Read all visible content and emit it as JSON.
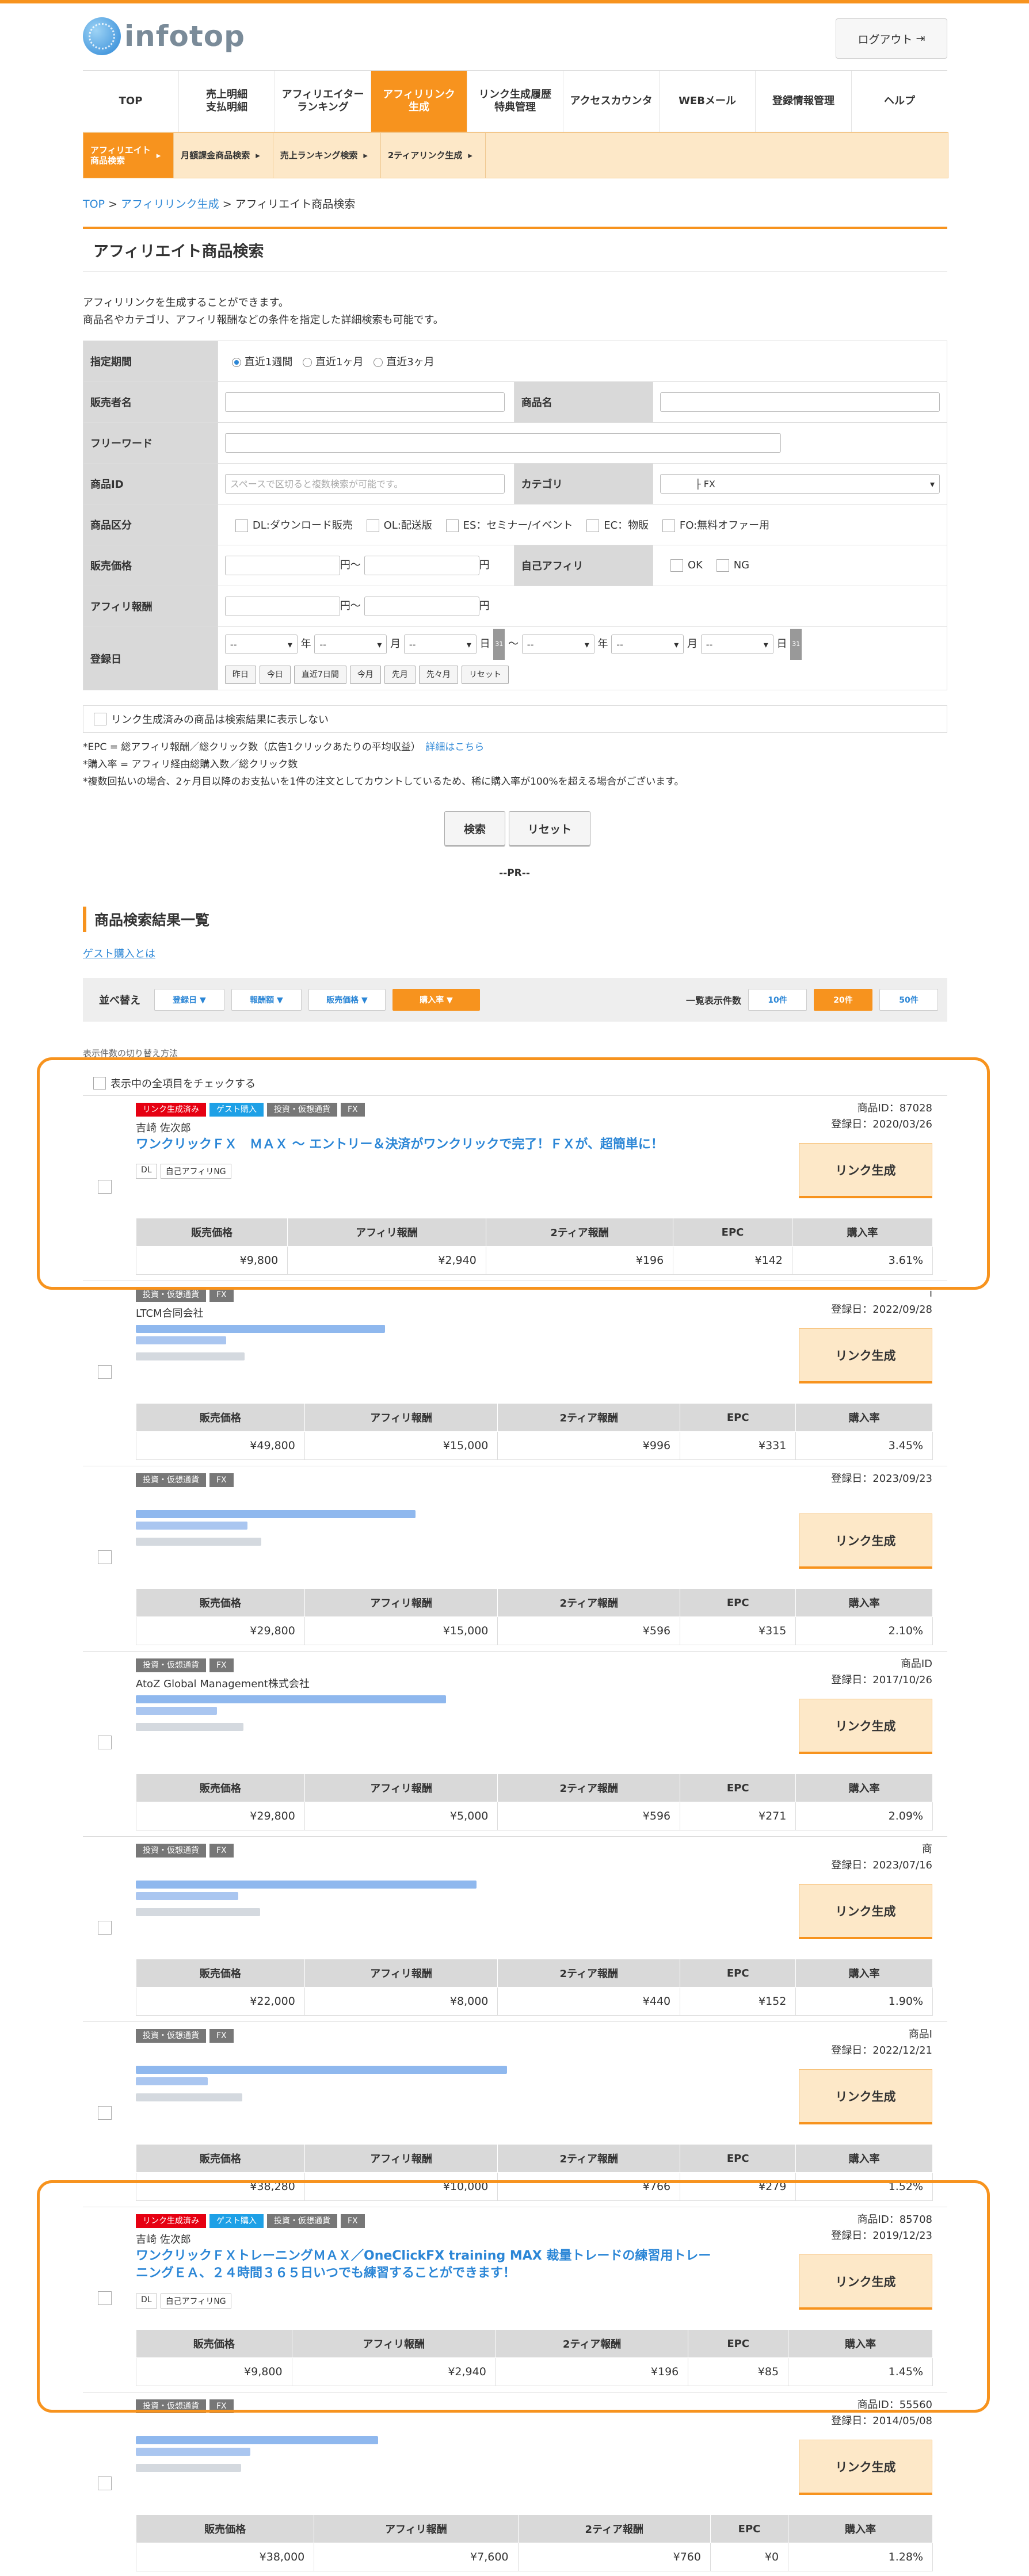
{
  "app": {
    "logo_text": "infotop",
    "logout_label": "ログアウト"
  },
  "gnav": [
    {
      "label": "TOP"
    },
    {
      "label": "売上明細\n支払明細"
    },
    {
      "label": "アフィリエイター\nランキング"
    },
    {
      "label": "アフィリリンク\n生成"
    },
    {
      "label": "リンク生成履歴\n特典管理"
    },
    {
      "label": "アクセスカウンタ"
    },
    {
      "label": "WEBメール"
    },
    {
      "label": "登録情報管理"
    },
    {
      "label": "ヘルプ"
    }
  ],
  "subnav": [
    {
      "label": "アフィリエイト\n商品検索"
    },
    {
      "label": "月額課金商品検索"
    },
    {
      "label": "売上ランキング検索"
    },
    {
      "label": "2ティアリンク生成"
    }
  ],
  "breadcrumb": {
    "top": "TOP",
    "sep1": " > ",
    "mid": "アフィリリンク生成",
    "sep2": " > ",
    "current": "アフィリエイト商品検索"
  },
  "page_title": "アフィリエイト商品検索",
  "intro": {
    "line1": "アフィリリンクを生成することができます。",
    "line2": "商品名やカテゴリ、アフィリ報酬などの条件を指定した詳細検索も可能です。"
  },
  "search": {
    "period_label": "指定期間",
    "period_options": [
      "直近1週間",
      "直近1ヶ月",
      "直近3ヶ月"
    ],
    "seller_label": "販売者名",
    "product_label": "商品名",
    "free_label": "フリーワード",
    "id_label": "商品ID",
    "id_placeholder": "スペースで区切ると複数検索が可能です。",
    "category_label": "カテゴリ",
    "category_value": "├ FX",
    "type_label": "商品区分",
    "type_options": [
      "DL:ダウンロード販売",
      "OL:配送版",
      "ES：セミナー/イベント",
      "EC：物販",
      "FO:無料オファー用"
    ],
    "price_label": "販売価格",
    "self_label": "自己アフィリ",
    "self_options": [
      "OK",
      "NG"
    ],
    "reward_label": "アフィリ報酬",
    "yen_from": "円〜",
    "yen": "円",
    "date_label": "登録日",
    "select_dash": "--",
    "y": "年",
    "m": "月",
    "d": "日",
    "tilde": "〜",
    "cal_icon": "31",
    "date_buttons": [
      "昨日",
      "今日",
      "直近7日間",
      "今月",
      "先月",
      "先々月",
      "リセット"
    ],
    "hide_linked": "リンク生成済みの商品は検索結果に表示しない"
  },
  "notes": {
    "epc": "*EPC = 総アフィリ報酬／総クリック数（広告1クリックあたりの平均収益）",
    "detail_link": "詳細はこちら",
    "rate": "*購入率 = アフィリ経由総購入数／総クリック数",
    "multi": "*複数回払いの場合、2ヶ月目以降のお支払いを1件の注文としてカウントしているため、稀に購入率が100%を超える場合がございます。"
  },
  "buttons": {
    "search": "検索",
    "reset": "リセット"
  },
  "pr": "--PR--",
  "results": {
    "title": "商品検索結果一覧",
    "guest_link": "ゲスト購入とは",
    "sort_label": "並べ替え",
    "sort_buttons": [
      "登録日 ▼",
      "報酬額 ▼",
      "販売価格 ▼",
      "購入率 ▼"
    ],
    "count_label": "一覧表示件数",
    "count_buttons": [
      "10件",
      "20件",
      "50件"
    ],
    "caption": "表示件数の切り替え方法",
    "check_all": "表示中の全項目をチェックする",
    "link_label": "リンク生成",
    "col_headers": [
      "販売価格",
      "アフィリ報酬",
      "2ティア報酬",
      "EPC",
      "購入率"
    ]
  },
  "items": [
    {
      "tags": [
        "リンク生成済み",
        "ゲスト購入",
        "投資・仮想通貨",
        "FX"
      ],
      "tag_colors": [
        "red",
        "blue",
        "gray",
        "gray"
      ],
      "seller": "吉崎 佐次郎",
      "title": "ワンクリックＦＸ　ＭＡＸ ～ エントリー＆決済がワンクリックで完了！ＦＸが、超簡単に！",
      "badges": [
        "DL",
        "自己アフィリNG"
      ],
      "id": "商品ID：87028",
      "date": "登録日：2020/03/26",
      "values": [
        "¥9,800",
        "¥2,940",
        "¥196",
        "¥142",
        "3.61%"
      ]
    },
    {
      "tags": [
        "投資・仮想通貨",
        "FX"
      ],
      "tag_colors": [
        "gray",
        "gray"
      ],
      "seller": "LTCM合同会社",
      "title": "",
      "badges": [],
      "id": "i",
      "date": "登録日：2022/09/28",
      "values": [
        "¥49,800",
        "¥15,000",
        "¥996",
        "¥331",
        "3.45%"
      ]
    },
    {
      "tags": [
        "投資・仮想通貨",
        "FX"
      ],
      "tag_colors": [
        "gray",
        "gray"
      ],
      "seller": "",
      "title": "",
      "badges": [],
      "id": "",
      "date": "登録日：2023/09/23",
      "values": [
        "¥29,800",
        "¥15,000",
        "¥596",
        "¥315",
        "2.10%"
      ]
    },
    {
      "tags": [
        "投資・仮想通貨",
        "FX"
      ],
      "tag_colors": [
        "gray",
        "gray"
      ],
      "seller": "AtoZ Global Management株式会社",
      "title": "",
      "badges": [],
      "id": "商品ID",
      "date": "登録日：2017/10/26",
      "values": [
        "¥29,800",
        "¥5,000",
        "¥596",
        "¥271",
        "2.09%"
      ]
    },
    {
      "tags": [
        "投資・仮想通貨",
        "FX"
      ],
      "tag_colors": [
        "gray",
        "gray"
      ],
      "seller": "",
      "title": "",
      "badges": [],
      "id": "商",
      "date": "登録日：2023/07/16",
      "values": [
        "¥22,000",
        "¥8,000",
        "¥440",
        "¥152",
        "1.90%"
      ]
    },
    {
      "tags": [
        "投資・仮想通貨",
        "FX"
      ],
      "tag_colors": [
        "gray",
        "gray"
      ],
      "seller": "",
      "title": "",
      "badges": [],
      "id": "商品I",
      "date": "登録日：2022/12/21",
      "values": [
        "¥38,280",
        "¥10,000",
        "¥766",
        "¥279",
        "1.52%"
      ]
    },
    {
      "tags": [
        "リンク生成済み",
        "ゲスト購入",
        "投資・仮想通貨",
        "FX"
      ],
      "tag_colors": [
        "red",
        "blue",
        "gray",
        "gray"
      ],
      "seller": "吉崎 佐次郎",
      "title": "ワンクリックＦＸトレーニングＭＡＸ／OneClickFX training MAX 裁量トレードの練習用トレーニングＥＡ、２４時間３６５日いつでも練習することができます！",
      "badges": [
        "DL",
        "自己アフィリNG"
      ],
      "id": "商品ID：85708",
      "date": "登録日：2019/12/23",
      "values": [
        "¥9,800",
        "¥2,940",
        "¥196",
        "¥85",
        "1.45%"
      ]
    },
    {
      "tags": [
        "投資・仮想通貨",
        "FX"
      ],
      "tag_colors": [
        "gray",
        "gray"
      ],
      "seller": "",
      "title": "",
      "badges": [],
      "id": "商品ID：55560",
      "date": "登録日：2014/05/08",
      "values": [
        "¥38,000",
        "¥7,600",
        "¥760",
        "¥0",
        "1.28%"
      ]
    }
  ]
}
